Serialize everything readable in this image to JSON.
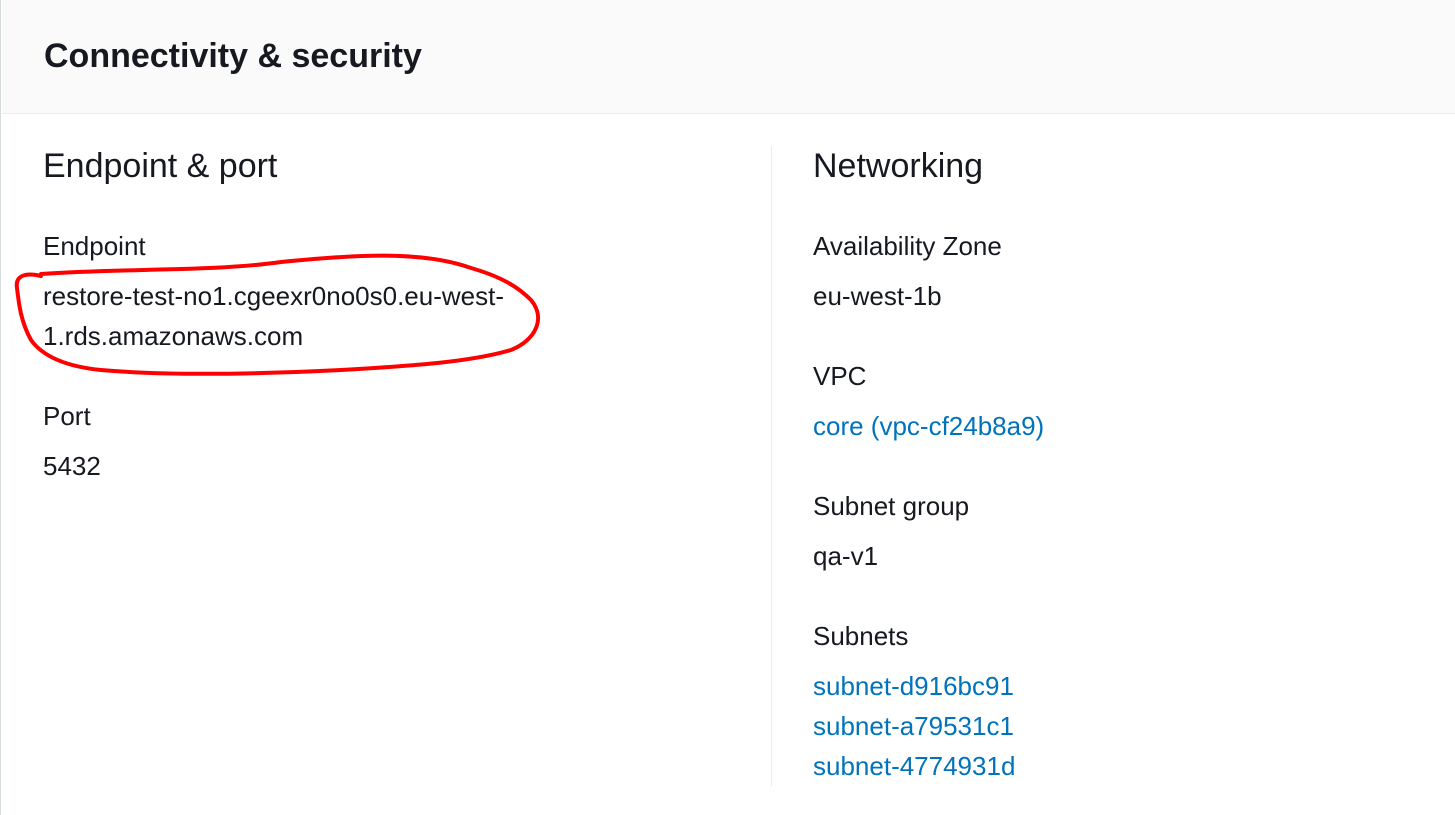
{
  "panel": {
    "title": "Connectivity & security"
  },
  "endpoint_port": {
    "heading": "Endpoint & port",
    "endpoint_label": "Endpoint",
    "endpoint_value": "restore-test-no1.cgeexr0no0s0.eu-west-1.rds.amazonaws.com",
    "port_label": "Port",
    "port_value": "5432"
  },
  "networking": {
    "heading": "Networking",
    "az_label": "Availability Zone",
    "az_value": "eu-west-1b",
    "vpc_label": "VPC",
    "vpc_value": "core (vpc-cf24b8a9)",
    "subnet_group_label": "Subnet group",
    "subnet_group_value": "qa-v1",
    "subnets_label": "Subnets",
    "subnets": [
      "subnet-d916bc91",
      "subnet-a79531c1",
      "subnet-4774931d"
    ]
  },
  "colors": {
    "link": "#0073bb",
    "annotation": "#ff0000",
    "header_bg": "#fafafa"
  }
}
